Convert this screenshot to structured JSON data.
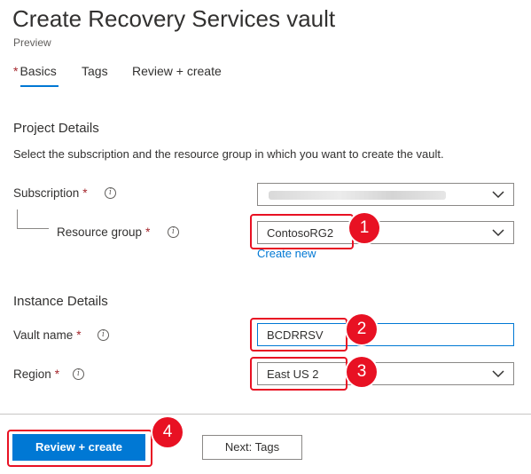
{
  "header": {
    "title": "Create Recovery Services vault",
    "subtitle": "Preview"
  },
  "tabs": [
    {
      "label": "Basics",
      "required_mark": "*",
      "active": true
    },
    {
      "label": "Tags"
    },
    {
      "label": "Review + create"
    }
  ],
  "project": {
    "title": "Project Details",
    "description": "Select the subscription and the resource group in which you want to create the vault.",
    "subscription_label": "Subscription",
    "resource_group_label": "Resource group",
    "resource_group_value": "ContosoRG2",
    "create_new_link": "Create new"
  },
  "instance": {
    "title": "Instance Details",
    "vault_name_label": "Vault name",
    "vault_name_value": "BCDRRSV",
    "region_label": "Region",
    "region_value": "East US 2"
  },
  "common": {
    "required_star": "*",
    "info_glyph": "i"
  },
  "callouts": [
    "1",
    "2",
    "3",
    "4"
  ],
  "footer": {
    "review_create_label": "Review + create",
    "next_label": "Next: Tags"
  },
  "colors": {
    "accent": "#0078d4",
    "callout_red": "#e81123",
    "required_red": "#a4262c"
  }
}
